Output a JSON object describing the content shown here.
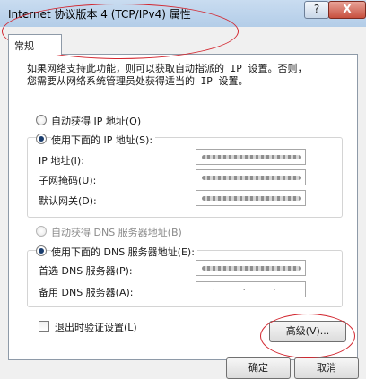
{
  "window": {
    "title": "Internet 协议版本 4 (TCP/IPv4) 属性",
    "help_label": "?",
    "close_label": "X"
  },
  "tabs": [
    {
      "label": "常规"
    }
  ],
  "description": [
    "如果网络支持此功能，则可以获取自动指派的 IP 设置。否则，",
    "您需要从网络系统管理员处获得适当的 IP 设置。"
  ],
  "ip_section": {
    "auto_label": "自动获得 IP 地址(O)",
    "manual_label": "使用下面的 IP 地址(S):",
    "selected": "manual",
    "fields": [
      {
        "label": "IP 地址(I):"
      },
      {
        "label": "子网掩码(U):"
      },
      {
        "label": "默认网关(D):"
      }
    ]
  },
  "dns_section": {
    "auto_label": "自动获得 DNS 服务器地址(B)",
    "manual_label": "使用下面的 DNS 服务器地址(E):",
    "selected": "manual",
    "fields": [
      {
        "label": "首选 DNS 服务器(P):"
      },
      {
        "label": "备用 DNS 服务器(A):",
        "value": ". . ."
      }
    ]
  },
  "validate_label": "退出时验证设置(L)",
  "advanced_label": "高级(V)...",
  "ok_label": "确定",
  "cancel_label": "取消",
  "colors": {
    "annotation": "#d2262f",
    "titlebar": "#b3cde8"
  }
}
